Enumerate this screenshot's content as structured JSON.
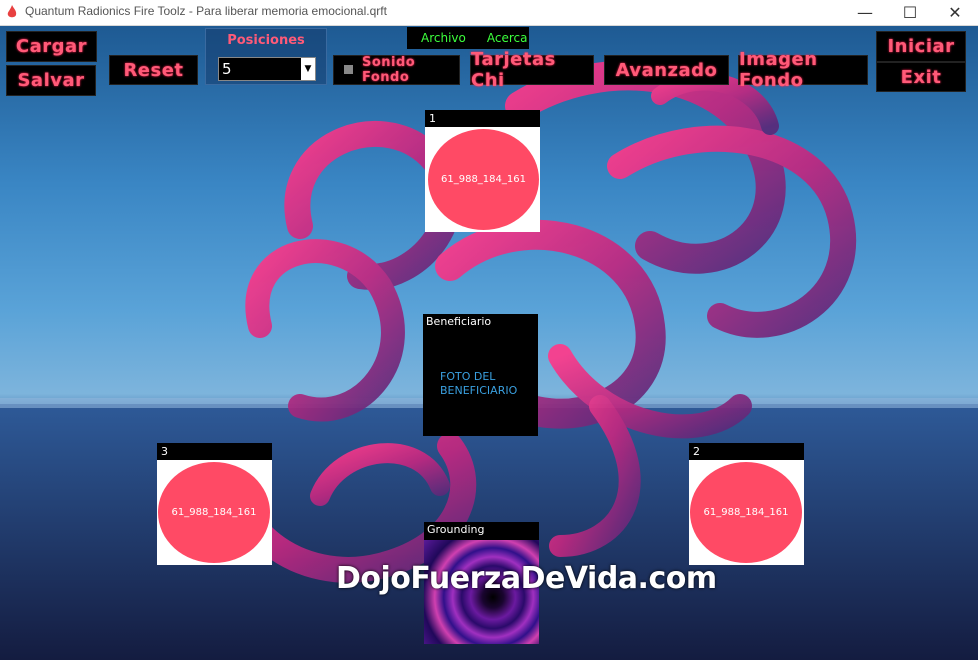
{
  "window": {
    "title": "Quantum Radionics Fire Toolz - Para liberar memoria emocional.qrft",
    "minimize": "—",
    "maximize": "☐",
    "close": "✕"
  },
  "menu": {
    "archivo": "Archivo",
    "acerca": "Acerca"
  },
  "buttons": {
    "cargar": "Cargar",
    "salvar": "Salvar",
    "reset": "Reset",
    "sonido_fondo": "Sonido Fondo",
    "tarjetas_chi": "Tarjetas Chi",
    "avanzado": "Avanzado",
    "imagen_fondo": "Imagen Fondo",
    "iniciar": "Iniciar",
    "exit": "Exit"
  },
  "posiciones": {
    "label": "Posiciones",
    "value": "5"
  },
  "cards": [
    {
      "header": "1",
      "code": "61_988_184_161"
    },
    {
      "header": "2",
      "code": "61_988_184_161"
    },
    {
      "header": "3",
      "code": "61_988_184_161"
    }
  ],
  "beneficiario": {
    "header": "Beneficiario",
    "line1": "FOTO DEL",
    "line2": "BENEFICIARIO"
  },
  "grounding": {
    "header": "Grounding"
  },
  "watermark": "DojoFuerzaDeVida.com",
  "colors": {
    "button_text": "#ff5a78",
    "card_circle": "#ff4a65",
    "menu_text": "#3cff3c",
    "benef_text": "#3aa0e0"
  }
}
